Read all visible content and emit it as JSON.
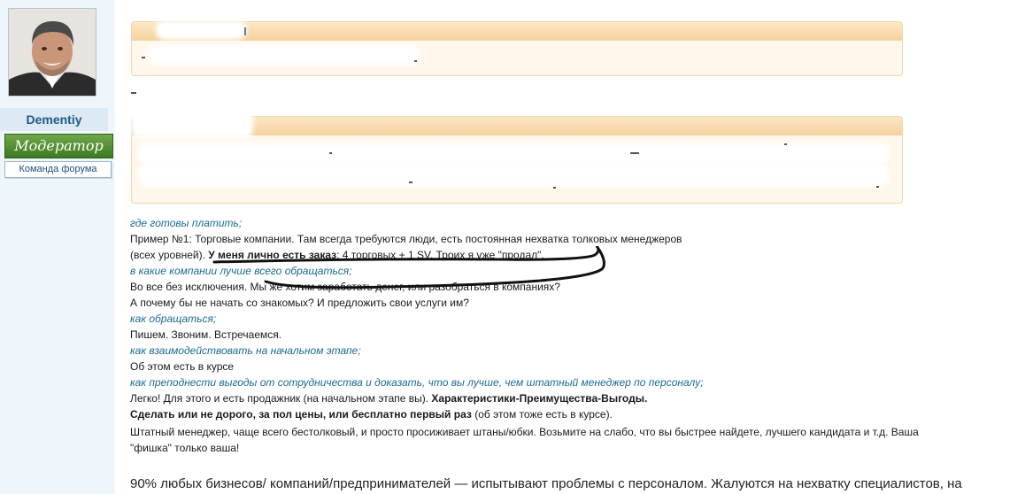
{
  "user": {
    "name": "Dementiy",
    "rank": "Модератор",
    "team_link": "Команда форума",
    "avatar": "user-photo"
  },
  "post": {
    "lines": [
      {
        "type": "question",
        "text": "где готовы платить;"
      },
      {
        "type": "plain",
        "text": "Пример №1: Торговые компании. Там всегда требуются люди, есть постоянная нехватка толковых менеджеров"
      },
      {
        "type": "mixed",
        "before": "(всех уровней). ",
        "bold": "У меня лично есть заказ",
        "after": ": 4 торговых + 1 SV. Троих я уже \"продал\"."
      },
      {
        "type": "question",
        "text": "в какие компании лучше всего обращаться;"
      },
      {
        "type": "plain",
        "text": "Во все без исключения. Мы же хотим заработать денег, или разобраться в компаниях?"
      },
      {
        "type": "plain",
        "text": "А почему бы не начать со знакомых? И предложить свои услуги им?"
      },
      {
        "type": "question",
        "text": "как обращаться;"
      },
      {
        "type": "plain",
        "text": "Пишем. Звоним. Встречаемся."
      },
      {
        "type": "question",
        "text": "как взаимодействовать на начальном этапе;"
      },
      {
        "type": "plain",
        "text": "Об этом есть в курсе"
      },
      {
        "type": "question",
        "text": "как преподнести выгоды от сотрудничества и доказать, что вы лучше, чем штатный менеджер по персоналу;"
      },
      {
        "type": "mixed",
        "before": "Легко! Для этого и есть продажник (на начальном этапе вы). ",
        "bold": "Характеристики-Преимущества-Выгоды.",
        "after": ""
      },
      {
        "type": "mixed",
        "before": "",
        "bold": "Сделать или не дорого, за пол цены, или бесплатно первый раз",
        "after": " (об этом тоже есть в курсе)."
      },
      {
        "type": "plain",
        "text": "Штатный менеджер, чаще всего бестолковый, и просто просиживает штаны/юбки. Возьмите на слабо, что вы быстрее найдете, лучшего кандидата и т.д. Ваша"
      },
      {
        "type": "plain",
        "text": "\"фишка\" только ваша!"
      }
    ],
    "final_paragraph": "90% любых бизнесов/ компаний/предпринимателей — испытывают проблемы с персоналом. Жалуются на нехватку специалистов, на"
  },
  "colors": {
    "question": "#1c6a91",
    "quote_bg": "#fff7ec",
    "quote_head": "#f6d39f",
    "rank_green": "#3d7a21"
  }
}
